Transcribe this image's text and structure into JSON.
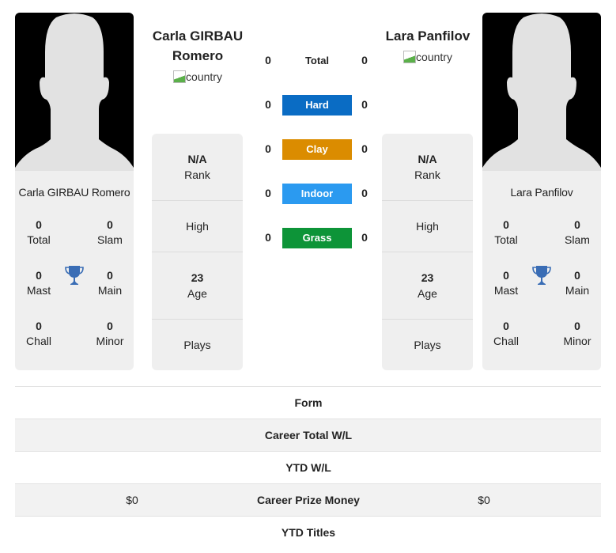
{
  "players": {
    "left": {
      "name": "Carla GIRBAU Romero",
      "name_line1": "Carla GIRBAU",
      "name_line2": "Romero",
      "country_alt": "country",
      "titles": {
        "total": {
          "value": "0",
          "label": "Total"
        },
        "slam": {
          "value": "0",
          "label": "Slam"
        },
        "mast": {
          "value": "0",
          "label": "Mast"
        },
        "main": {
          "value": "0",
          "label": "Main"
        },
        "chall": {
          "value": "0",
          "label": "Chall"
        },
        "minor": {
          "value": "0",
          "label": "Minor"
        }
      },
      "stats": {
        "rank": {
          "value": "N/A",
          "label": "Rank"
        },
        "high": {
          "value": "",
          "label": "High"
        },
        "age": {
          "value": "23",
          "label": "Age"
        },
        "plays": {
          "value": "",
          "label": "Plays"
        }
      }
    },
    "right": {
      "name": "Lara Panfilov",
      "country_alt": "country",
      "titles": {
        "total": {
          "value": "0",
          "label": "Total"
        },
        "slam": {
          "value": "0",
          "label": "Slam"
        },
        "mast": {
          "value": "0",
          "label": "Mast"
        },
        "main": {
          "value": "0",
          "label": "Main"
        },
        "chall": {
          "value": "0",
          "label": "Chall"
        },
        "minor": {
          "value": "0",
          "label": "Minor"
        }
      },
      "stats": {
        "rank": {
          "value": "N/A",
          "label": "Rank"
        },
        "high": {
          "value": "",
          "label": "High"
        },
        "age": {
          "value": "23",
          "label": "Age"
        },
        "plays": {
          "value": "",
          "label": "Plays"
        }
      }
    }
  },
  "surfaces": [
    {
      "label": "Total",
      "left": "0",
      "right": "0",
      "color": ""
    },
    {
      "label": "Hard",
      "left": "0",
      "right": "0",
      "color": "#0a6cc4"
    },
    {
      "label": "Clay",
      "left": "0",
      "right": "0",
      "color": "#db8c00"
    },
    {
      "label": "Indoor",
      "left": "0",
      "right": "0",
      "color": "#2b9af0"
    },
    {
      "label": "Grass",
      "left": "0",
      "right": "0",
      "color": "#0d9438"
    }
  ],
  "comparison": [
    {
      "label": "Form",
      "left": "",
      "right": ""
    },
    {
      "label": "Career Total W/L",
      "left": "",
      "right": ""
    },
    {
      "label": "YTD W/L",
      "left": "",
      "right": ""
    },
    {
      "label": "Career Prize Money",
      "left": "$0",
      "right": "$0"
    },
    {
      "label": "YTD Titles",
      "left": "",
      "right": ""
    }
  ],
  "colors": {
    "trophy": "#3a6db5",
    "card_bg": "#efefef"
  }
}
